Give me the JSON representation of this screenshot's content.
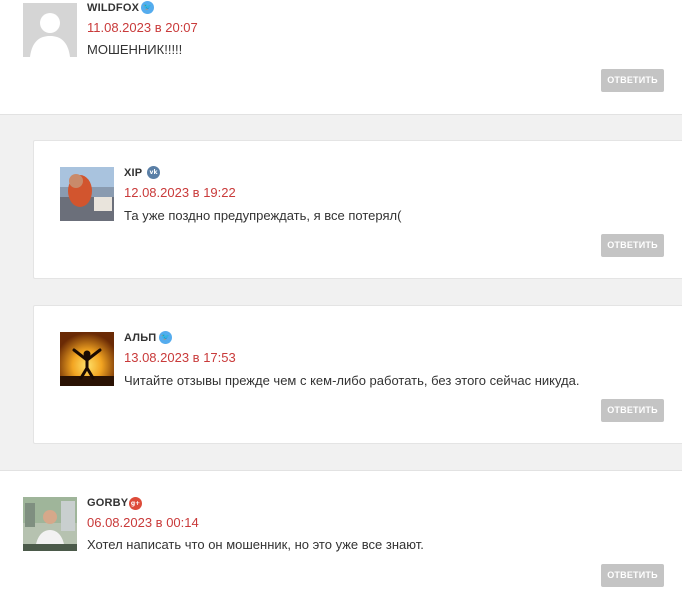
{
  "comments": [
    {
      "author": "WILDFOX",
      "network_icon": "twitter-icon",
      "date": "11.08.2023 в 20:07",
      "text": "МОШЕННИК!!!!!",
      "reply_label": "ОТВЕТИТЬ"
    },
    {
      "author": "XIP",
      "network_icon": "vk-icon",
      "date": "12.08.2023 в 19:22",
      "text": "Та уже поздно предупреждать, я все потерял(",
      "reply_label": "ОТВЕТИТЬ"
    },
    {
      "author": "АЛЬП",
      "network_icon": "twitter-icon",
      "date": "13.08.2023 в 17:53",
      "text": "Читайте отзывы прежде чем с кем-либо работать, без этого сейчас никуда.",
      "reply_label": "ОТВЕТИТЬ"
    },
    {
      "author": "GORBY",
      "network_icon": "google-plus-icon",
      "date": "06.08.2023 в 00:14",
      "text": "Хотел написать что он мошенник, но это уже все знают.",
      "reply_label": "ОТВЕТИТЬ"
    }
  ],
  "icons": {
    "twitter": "🐦",
    "vk": "vk",
    "google_plus": "g+"
  },
  "colors": {
    "date": "#c93a3a",
    "twitter": "#55acee",
    "vk": "#5a7fa6",
    "google_plus": "#dd4b39",
    "reply_button": "#c4c4c4",
    "band": "#f1f1f1"
  }
}
